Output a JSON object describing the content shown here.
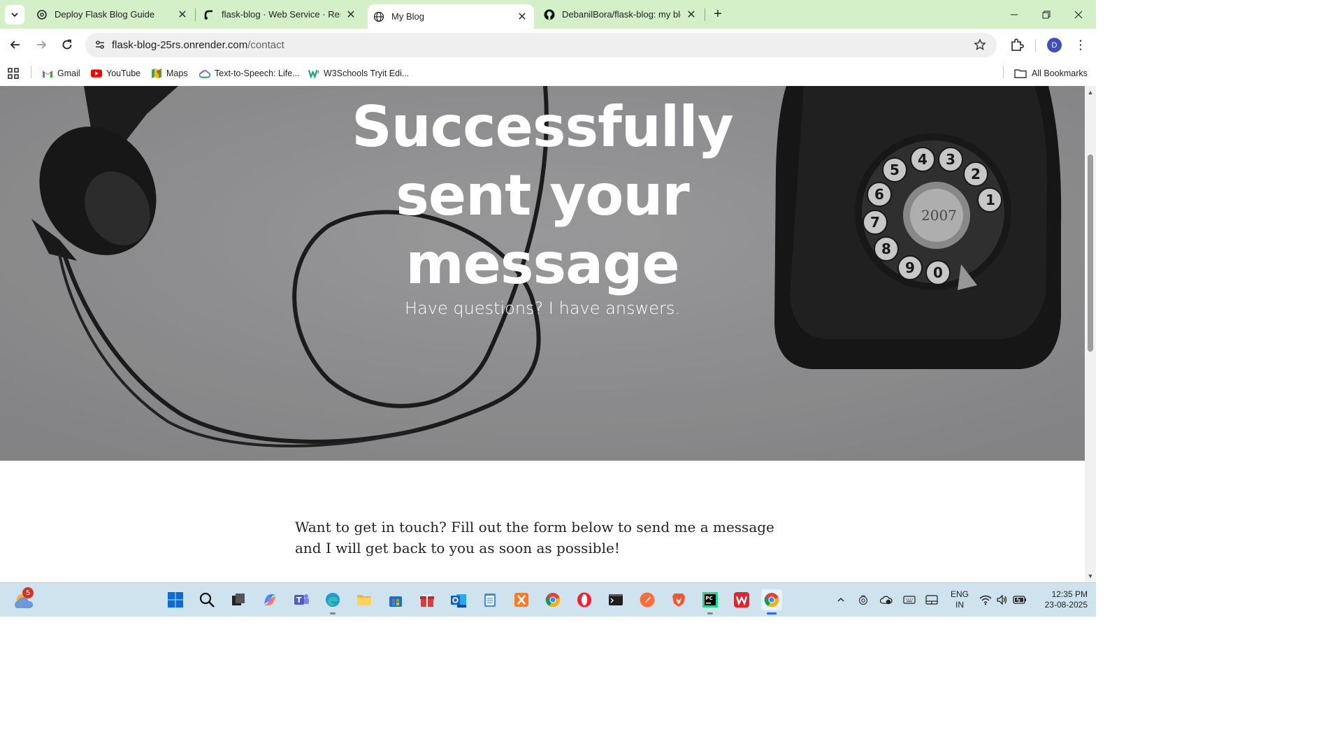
{
  "browser": {
    "tabs": [
      {
        "title": "Deploy Flask Blog Guide",
        "icon": "openai-icon",
        "active": false
      },
      {
        "title": "flask-blog · Web Service · Render",
        "icon": "render-icon",
        "active": false
      },
      {
        "title": "My Blog",
        "icon": "globe-icon",
        "active": true
      },
      {
        "title": "DebanilBora/flask-blog: my blog",
        "icon": "github-icon",
        "active": false
      }
    ],
    "address": {
      "domain": "flask-blog-25rs.onrender.com",
      "path": "/contact"
    },
    "profile_initial": "D",
    "bookmarks": [
      {
        "label": "Gmail",
        "icon": "gmail-icon"
      },
      {
        "label": "YouTube",
        "icon": "youtube-icon"
      },
      {
        "label": "Maps",
        "icon": "maps-icon"
      },
      {
        "label": "Text-to-Speech: Life...",
        "icon": "google-cloud-icon"
      },
      {
        "label": "W3Schools Tryit Edi...",
        "icon": "w3schools-icon"
      }
    ],
    "all_bookmarks_label": "All Bookmarks"
  },
  "page": {
    "hero": {
      "heading_lines": [
        "Successfully",
        "sent your",
        "message"
      ],
      "subheading": "Have questions? I have answers."
    },
    "intro": "Want to get in touch? Fill out the form below to send me a message and I will get back to you as soon as possible!"
  },
  "taskbar": {
    "weather_badge": "5",
    "apps": [
      "start",
      "search",
      "task-view",
      "copilot",
      "teams",
      "edge",
      "file-explorer",
      "microsoft-store",
      "gift",
      "outlook-new",
      "notepad",
      "xampp",
      "chrome",
      "opera",
      "terminal",
      "postman",
      "brave",
      "pycharm",
      "wps-office",
      "chrome-active"
    ],
    "language": {
      "line1": "ENG",
      "line2": "IN"
    },
    "time": "12:35 PM",
    "date": "23-08-2025"
  },
  "colors": {
    "tabstrip_bg": "#d3f0c8",
    "taskbar_bg": "#cfe3ef",
    "hero_bg": "#8e8e90",
    "profile_bg": "#3f51b5"
  }
}
